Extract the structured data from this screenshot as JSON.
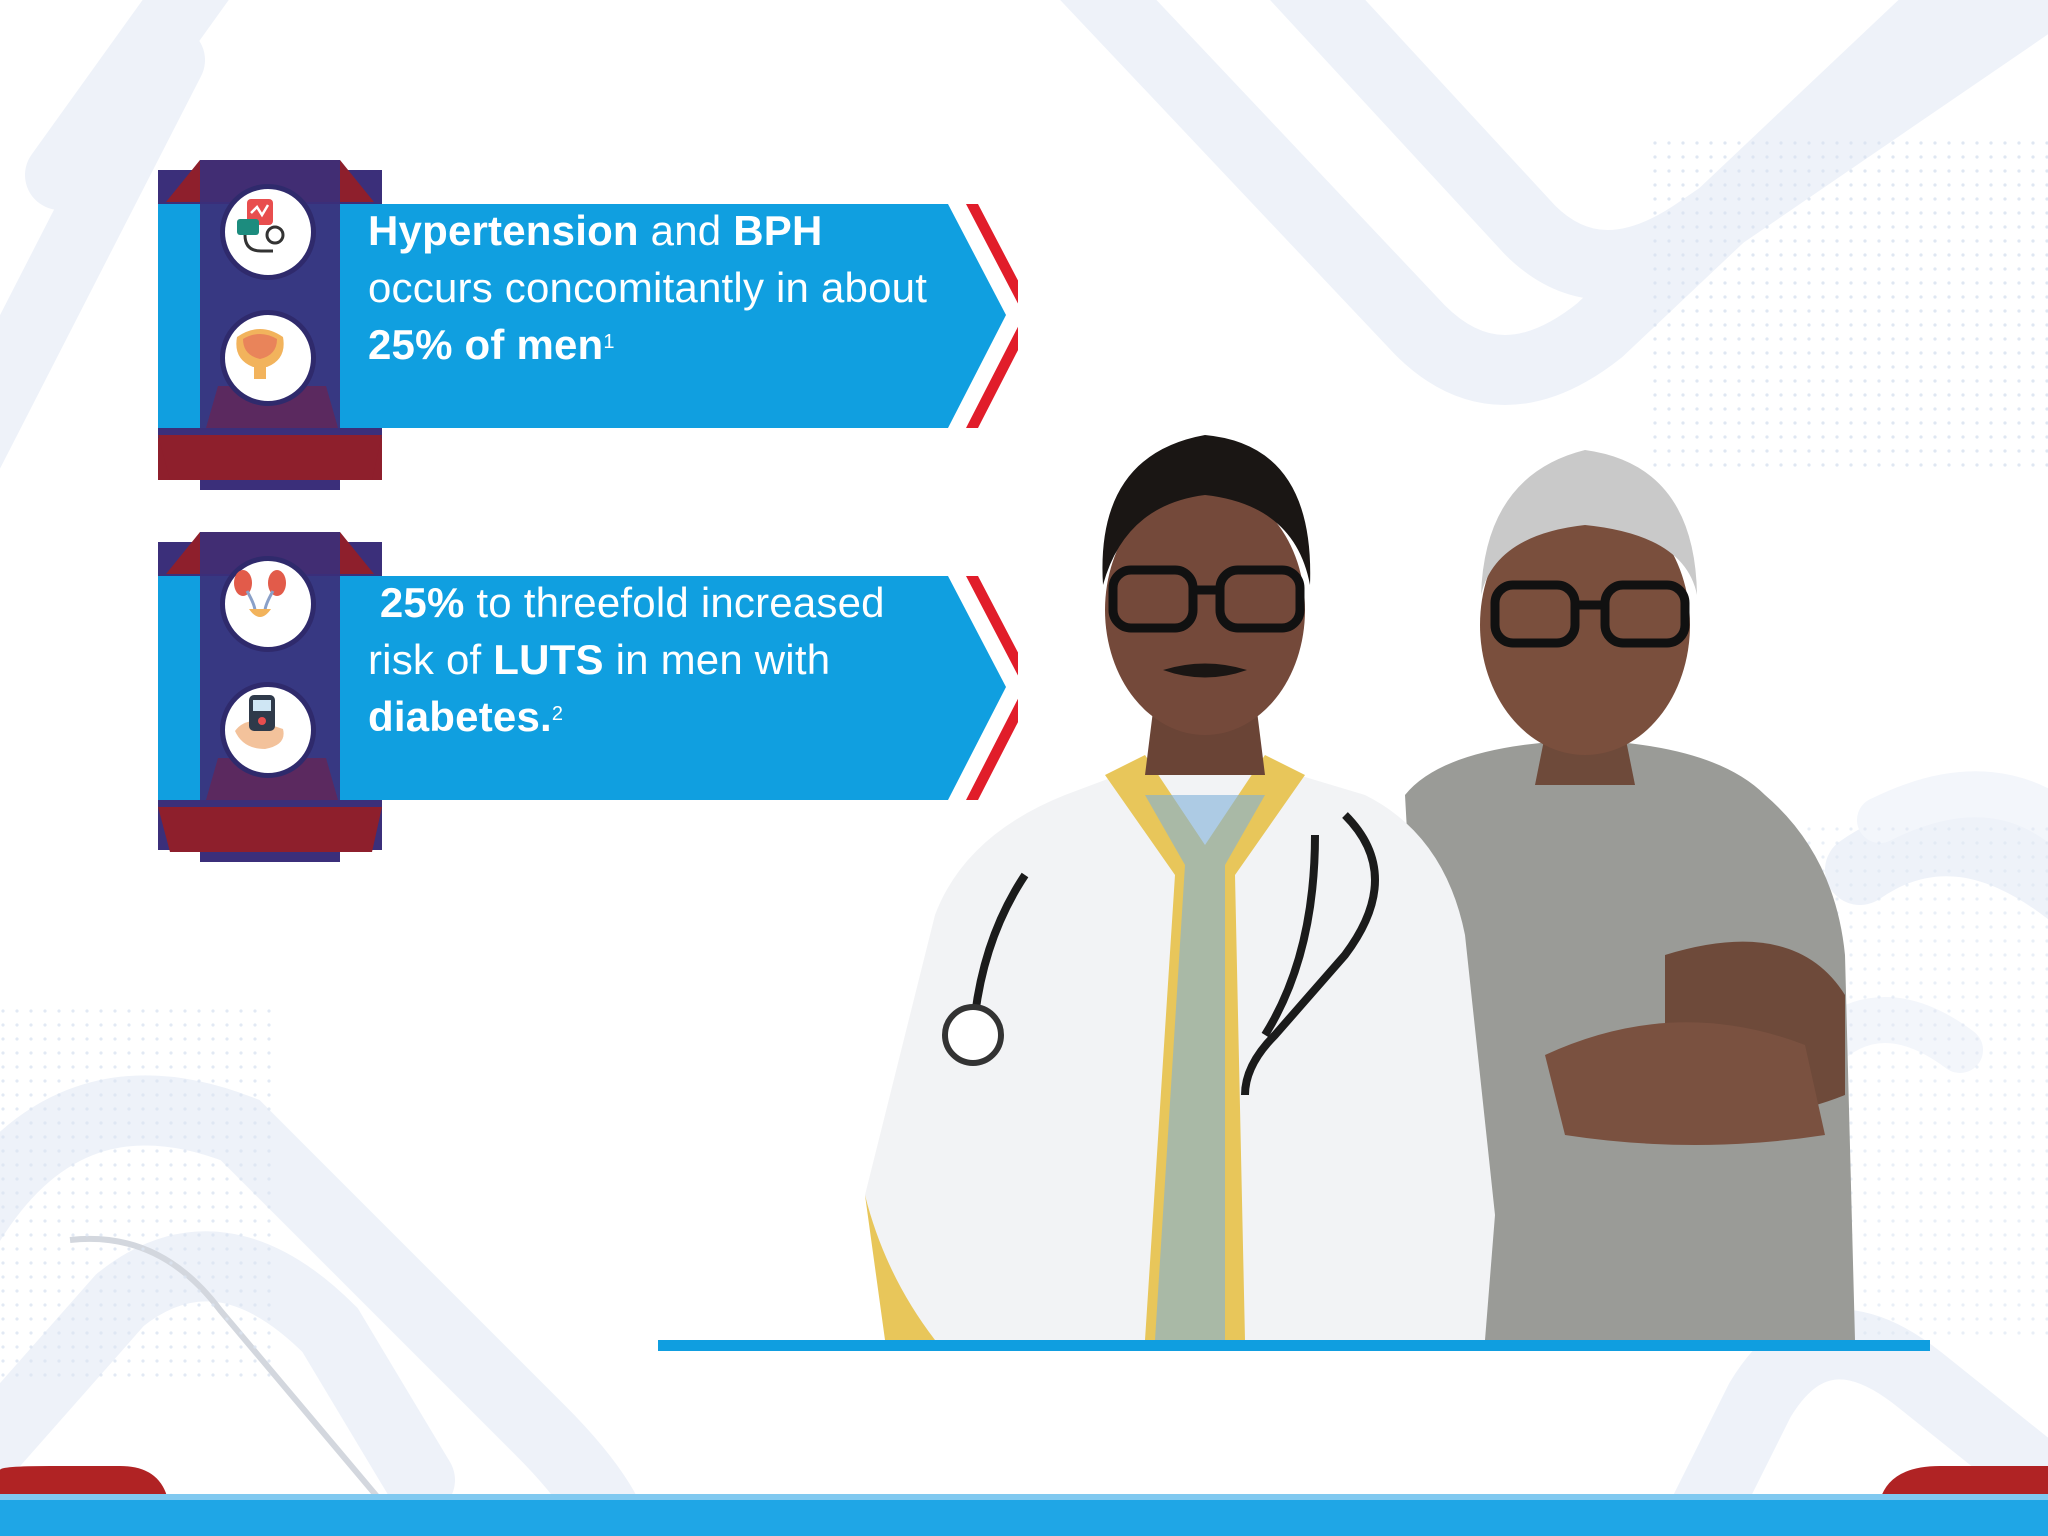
{
  "banners": [
    {
      "icons": [
        "blood-pressure-icon",
        "prostate-bladder-icon"
      ],
      "parts": [
        {
          "t": "Hypertension",
          "bold": true
        },
        {
          "t": " and ",
          "bold": false
        },
        {
          "t": "BPH",
          "bold": true
        },
        {
          "t": " occurs concomitantly in about ",
          "bold": false
        },
        {
          "t": "25% of men",
          "bold": true
        }
      ],
      "footnote": "1"
    },
    {
      "icons": [
        "kidneys-urinary-icon",
        "glucometer-icon"
      ],
      "parts": [
        {
          "t": " 25%",
          "bold": true
        },
        {
          "t": " to threefold increased risk of ",
          "bold": false
        },
        {
          "t": "LUTS",
          "bold": true
        },
        {
          "t": " in men with ",
          "bold": false
        },
        {
          "t": "diabetes.",
          "bold": true
        }
      ],
      "footnote": "2"
    }
  ],
  "colors": {
    "banner_blue": "#109fe0",
    "ribbon_purple": "#3b2f7a",
    "ribbon_red": "#8e1f2c",
    "accent_red": "#e11d2a",
    "baseline_blue": "#0f9ee0"
  },
  "image": {
    "subject": "photo-doctor-and-patient"
  }
}
